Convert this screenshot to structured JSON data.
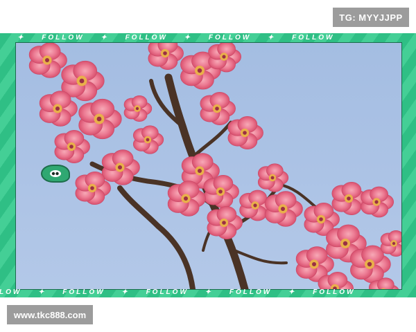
{
  "top_badge": {
    "text": "TG: MYYJJPP"
  },
  "bottom_badge": {
    "text": "www.tkc888.com"
  },
  "frame": {
    "strip_text": "FOLLOW",
    "separator": "✦",
    "colors": {
      "frame_green": "#2fbf85",
      "frame_stripe": "#44cf96",
      "sky": "#a9c1e4",
      "blossom": "#e8637e"
    }
  },
  "photo": {
    "subject": "pink-plum-blossoms"
  },
  "icons": {
    "watch_badge": "eye-icon"
  }
}
